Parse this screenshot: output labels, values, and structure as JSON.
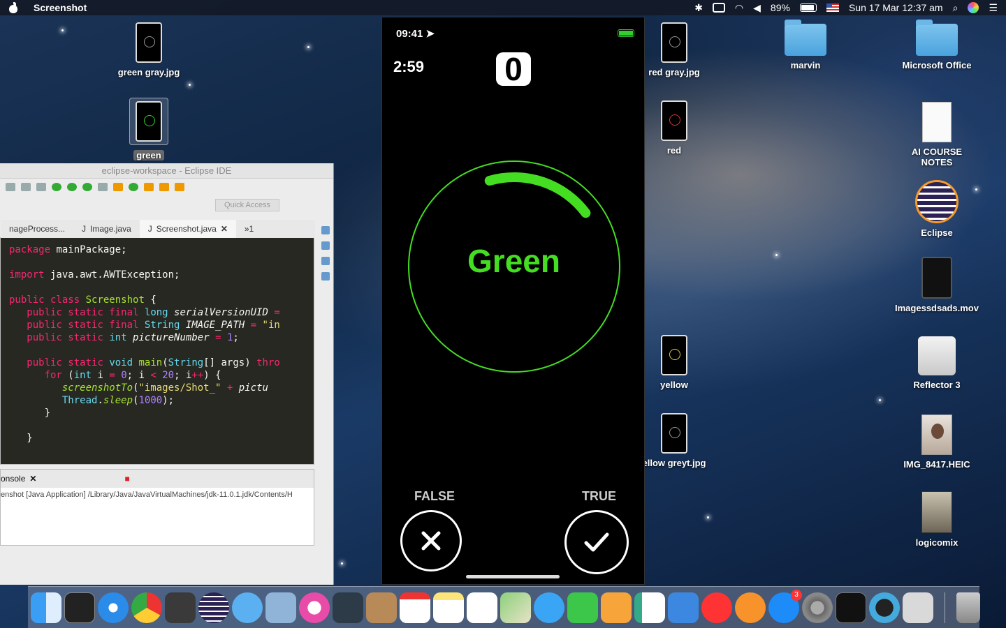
{
  "menubar": {
    "app_name": "Screenshot",
    "battery_percent": "89%",
    "datetime": "Sun 17 Mar  12:37 am"
  },
  "desktop_icons": {
    "green_gray": "green gray.jpg",
    "green": "green",
    "red_gray": "red gray.jpg",
    "red": "red",
    "marvin": "marvin",
    "microsoft_office": "Microsoft Office",
    "ai_course_notes": "AI COURSE NOTES",
    "eclipse": "Eclipse",
    "imagessdsads": "Imagessdsads.mov",
    "yellow": "yellow",
    "reflector": "Reflector 3",
    "yellow_greyt": "ellow greyt.jpg",
    "img_8417": "IMG_8417.HEIC",
    "logicomix": "logicomix"
  },
  "eclipse": {
    "title": "eclipse-workspace - Eclipse IDE",
    "quick_access": "Quick Access",
    "tabs": [
      "nageProcess...",
      "Image.java",
      "Screenshot.java",
      "»1"
    ],
    "console_tab": "onsole",
    "console_line": "enshot [Java Application] /Library/Java/JavaVirtualMachines/jdk-11.0.1.jdk/Contents/H"
  },
  "phone": {
    "status_time": "09:41",
    "timer": "2:59",
    "score": "0",
    "word": "Green",
    "false_label": "FALSE",
    "true_label": "TRUE",
    "accent_color": "#44dd22",
    "ring_progress": 0.12
  },
  "dock": {
    "appstore_badge": "3"
  }
}
